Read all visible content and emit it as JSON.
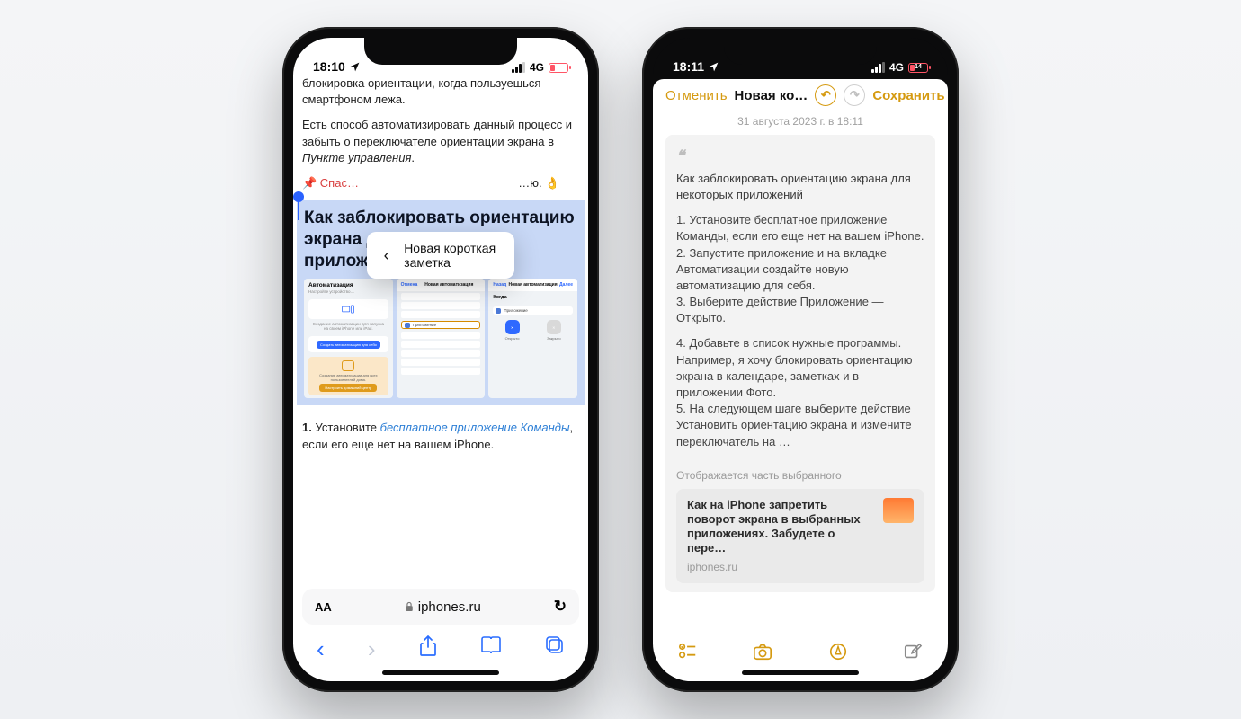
{
  "left": {
    "status": {
      "time": "18:10",
      "net": "4G",
      "battery": "14"
    },
    "article": {
      "p1": "блокировка ориентации, когда пользуешься смартфоном лежа.",
      "p2_a": "Есть способ автоматизировать данный процесс и забыть о переключателе ориентации экрана в ",
      "p2_b": "Пункте управления",
      "p2_c": ".",
      "thanks_a": "📌 Спас… ",
      "thanks_b": " …ю. 👌",
      "heading": "Как заблокировать ориентацию экрана для некоторых приложений",
      "step1_a": "1. ",
      "step1_b": "Установите ",
      "step1_link": "бесплатное приложение Команды",
      "step1_c": ", если его еще нет на вашем iPhone."
    },
    "quick_note": {
      "back": "‹",
      "title": "Новая короткая заметка"
    },
    "addr": {
      "aa": "AA",
      "lock": "🔒",
      "host": "iphones.ru",
      "reload": "↻"
    },
    "tabs": {
      "back": "‹",
      "fwd": "›",
      "share": "⇪",
      "books": "📖",
      "tabs": "🗂"
    }
  },
  "right": {
    "status": {
      "time": "18:11",
      "net": "4G",
      "battery": "14"
    },
    "hdr": {
      "cancel": "Отменить",
      "title": "Новая ко…",
      "undo": "↶",
      "redo": "↷",
      "save": "Сохранить"
    },
    "date": "31 августа 2023 г. в 18:11",
    "note": {
      "head": "Как заблокировать ориентацию экрана для некоторых приложений",
      "l1": "1. Установите бесплатное приложение Команды, если его еще нет на вашем iPhone.",
      "l2": "2. Запустите приложение и на вкладке Автоматизации создайте новую автоматизацию для себя.",
      "l3": "3. Выберите действие Приложение — Открыто.",
      "l4": "4. Добавьте в список нужные программы. Например, я хочу блокировать ориентацию экрана в календаре, заметках и в приложении Фото.",
      "l5": "5. На следующем шаге выберите действие Установить ориентацию экрана и измените переключатель на …",
      "footer": "Отображается часть выбранного"
    },
    "link": {
      "title": "Как на iPhone запретить поворот экрана в выбранных приложениях. Забудете о пере…",
      "domain": "iphones.ru"
    }
  }
}
